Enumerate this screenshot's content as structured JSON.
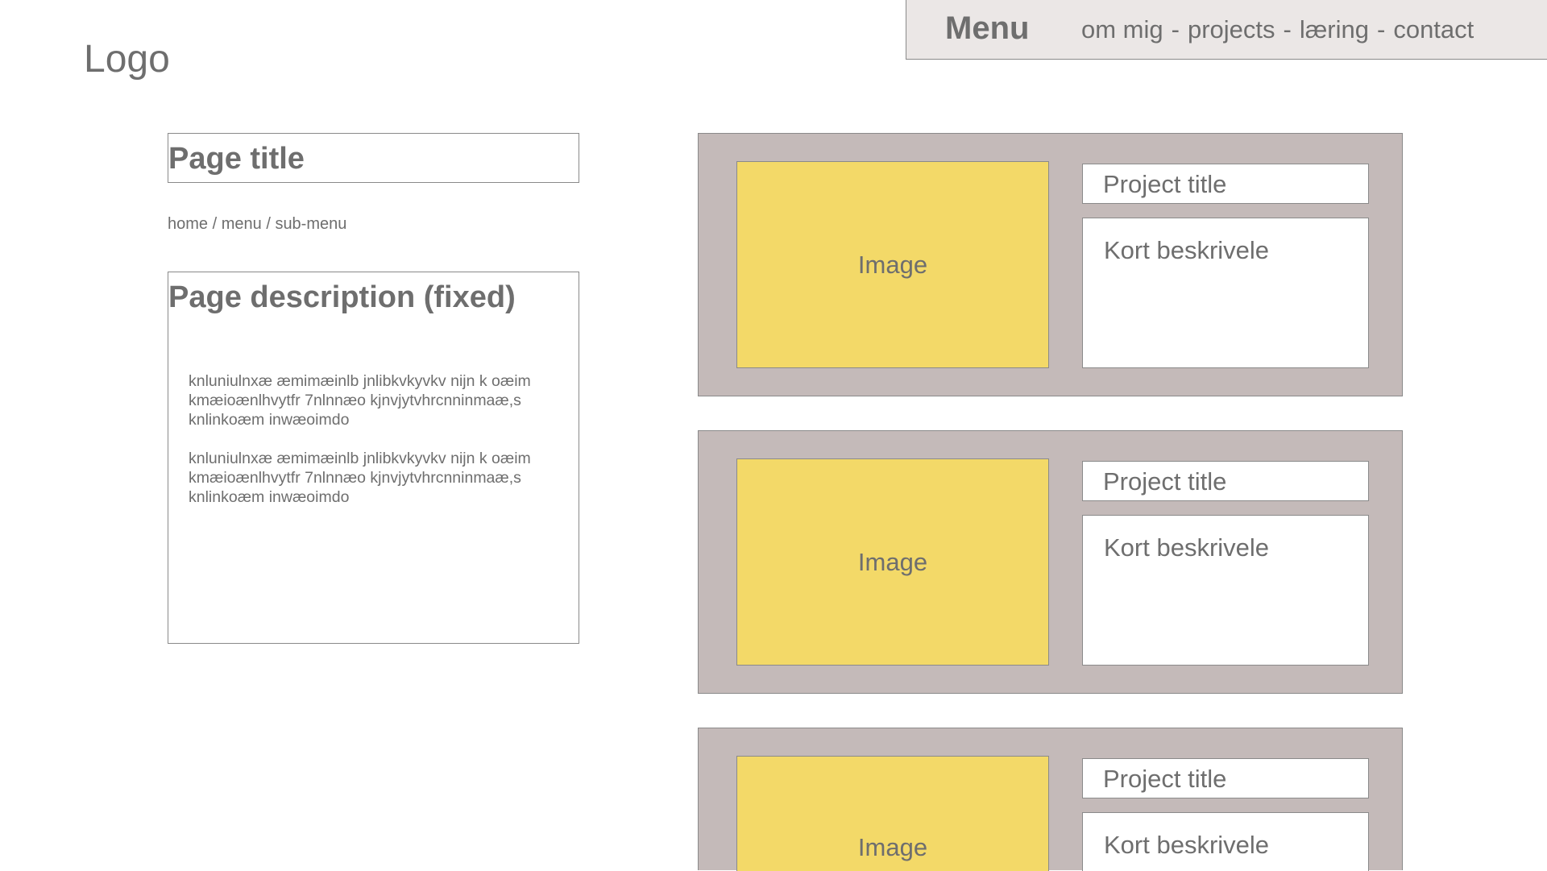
{
  "logo": {
    "text": "Logo"
  },
  "menu": {
    "title": "Menu",
    "separator": "-",
    "links": [
      "om mig",
      "projects",
      "læring",
      "contact"
    ]
  },
  "page": {
    "title": "Page title",
    "breadcrumb": {
      "separator": "/",
      "items": [
        "home",
        "menu",
        "sub-menu"
      ]
    },
    "description": {
      "heading": "Page description (fixed)",
      "paragraphs": [
        "knluniulnxæ æmimæinlb  jnlibkvkyvkv nijn k oæim kmæioænlhvytfr 7nlnnæo kjnvjytvhrcnninmaæ,s knlinkoæm inwæoimdo",
        "knluniulnxæ æmimæinlb  jnlibkvkyvkv nijn k oæim kmæioænlhvytfr 7nlnnæo kjnvjytvhrcnninmaæ,s knlinkoæm inwæoimdo"
      ]
    }
  },
  "projects": [
    {
      "image_label": "Image",
      "title": "Project title",
      "description": "Kort beskrivele"
    },
    {
      "image_label": "Image",
      "title": "Project title",
      "description": "Kort beskrivele"
    },
    {
      "image_label": "Image",
      "title": "Project title",
      "description": "Kort beskrivele"
    }
  ],
  "colors": {
    "menu_background": "#ebe7e6",
    "card_background": "#c4bab9",
    "image_placeholder": "#f3d968",
    "text": "#6e6e6e",
    "border": "#8a8a8a"
  }
}
